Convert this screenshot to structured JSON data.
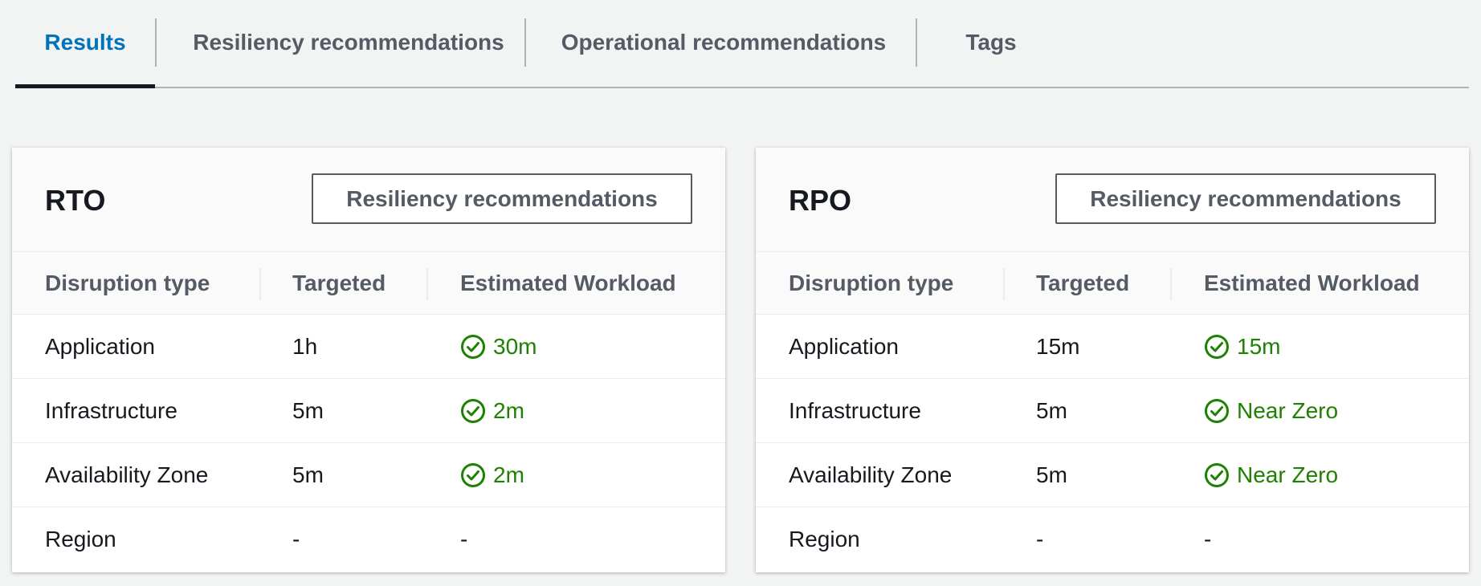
{
  "tabs": [
    {
      "label": "Results",
      "active": true
    },
    {
      "label": "Resiliency recommendations",
      "active": false
    },
    {
      "label": "Operational recommendations",
      "active": false
    },
    {
      "label": "Tags",
      "active": false
    }
  ],
  "colors": {
    "active_tab": "#0073bb",
    "success": "#1d8102",
    "text": "#16191f",
    "muted": "#545b64",
    "background": "#f2f3f3"
  },
  "panels": [
    {
      "title": "RTO",
      "button_label": "Resiliency recommendations",
      "columns": [
        "Disruption type",
        "Targeted",
        "Estimated Workload"
      ],
      "rows": [
        {
          "type": "Application",
          "targeted": "1h",
          "estimated": "30m",
          "status_icon": "check-circle-icon"
        },
        {
          "type": "Infrastructure",
          "targeted": "5m",
          "estimated": "2m",
          "status_icon": "check-circle-icon"
        },
        {
          "type": "Availability Zone",
          "targeted": "5m",
          "estimated": "2m",
          "status_icon": "check-circle-icon"
        },
        {
          "type": "Region",
          "targeted": "-",
          "estimated": "-",
          "status_icon": ""
        }
      ]
    },
    {
      "title": "RPO",
      "button_label": "Resiliency recommendations",
      "columns": [
        "Disruption type",
        "Targeted",
        "Estimated Workload"
      ],
      "rows": [
        {
          "type": "Application",
          "targeted": "15m",
          "estimated": "15m",
          "status_icon": "check-circle-icon"
        },
        {
          "type": "Infrastructure",
          "targeted": "5m",
          "estimated": "Near Zero",
          "status_icon": "check-circle-icon"
        },
        {
          "type": "Availability Zone",
          "targeted": "5m",
          "estimated": "Near Zero",
          "status_icon": "check-circle-icon"
        },
        {
          "type": "Region",
          "targeted": "-",
          "estimated": "-",
          "status_icon": ""
        }
      ]
    }
  ]
}
